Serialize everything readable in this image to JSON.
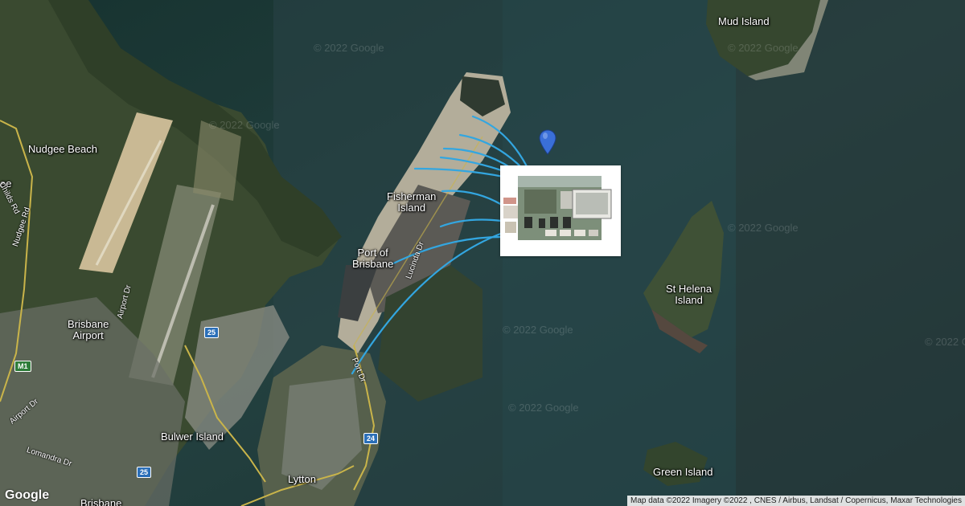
{
  "places": {
    "mud_island": "Mud Island",
    "nudgee_beach": "Nudgee Beach",
    "fisherman_island": "Fisherman\nIsland",
    "port_of_brisbane": "Port of\nBrisbane",
    "st_helena_island": "St Helena\nIsland",
    "brisbane_airport": "Brisbane\nAirport",
    "bulwer_island": "Bulwer Island",
    "green_island": "Green Island",
    "lytton": "Lytton",
    "edge_ee": "ee",
    "edge_brisb": "Brisbane"
  },
  "roads": {
    "childs_rd": "Childs Rd",
    "nudgee_rd": "Nudgee Rd",
    "airport_dr_1": "Airport Dr",
    "airport_dr_2": "Airport Dr",
    "lucinda_dr": "Lucinda Dr",
    "port_dr": "Port Dr",
    "lomandra_dr": "Lomandra Dr"
  },
  "shields": {
    "m1": "M1",
    "r25a": "25",
    "r25b": "25",
    "r24": "24"
  },
  "watermark": "© 2022 Google",
  "attribution": "Map data ©2022 Imagery ©2022 , CNES / Airbus, Landsat / Copernicus, Maxar Technologies",
  "google_logo": "Google",
  "colors": {
    "sea": "#1f3b3a",
    "land": "#3b4a2f",
    "connector_lines": "#33a6e0",
    "marker": "#3a6fd8"
  }
}
